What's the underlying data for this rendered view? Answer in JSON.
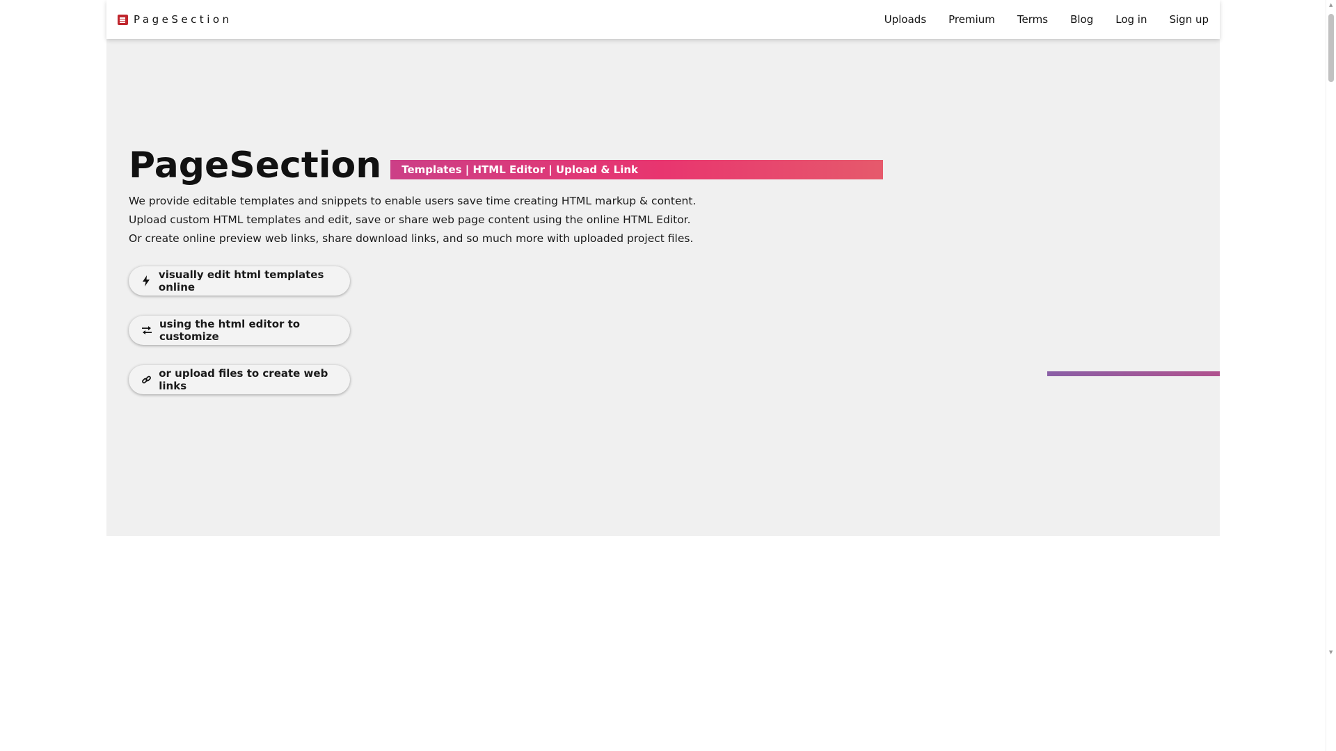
{
  "navbar": {
    "brand": "PageSection",
    "links": [
      {
        "label": "Uploads"
      },
      {
        "label": "Premium"
      },
      {
        "label": "Terms"
      },
      {
        "label": "Blog"
      },
      {
        "label": "Log in"
      },
      {
        "label": "Sign up"
      }
    ]
  },
  "hero": {
    "title": "PageSection",
    "tagline": "Templates | HTML Editor | Upload & Link",
    "description": [
      "We provide editable templates and snippets to enable users save time creating HTML markup & content.",
      "Upload custom HTML templates and edit, save or share web page content using the online HTML Editor.",
      "Or create online preview web links, share download links, and so much more with uploaded project files."
    ],
    "buttons": [
      {
        "label": "visually edit html templates online",
        "icon": "bolt-icon"
      },
      {
        "label": "using the html editor to customize",
        "icon": "exchange-icon"
      },
      {
        "label": "or upload files to create web links",
        "icon": "link-icon"
      }
    ]
  },
  "colors": {
    "brand_red": "#c0262d",
    "tagline_gradient_start": "#cc3f87",
    "tagline_gradient_end": "#e65a6c",
    "hero_bg": "#f0f0f0",
    "accent_bar": "#8a5fa6"
  }
}
